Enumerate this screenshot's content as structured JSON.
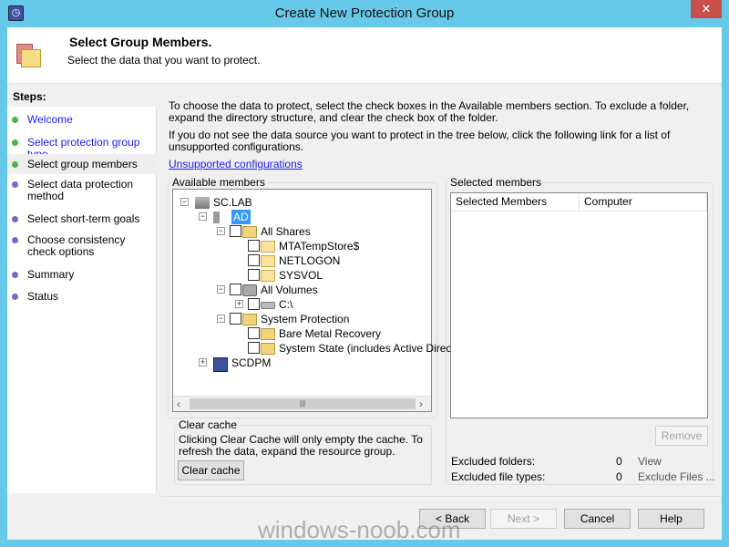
{
  "window": {
    "title": "Create New Protection Group",
    "close_glyph": "✕"
  },
  "header": {
    "title": "Select Group Members.",
    "subtitle": "Select the data that you want to protect."
  },
  "steps": {
    "heading": "Steps:",
    "items": [
      {
        "label": "Welcome",
        "state": "done",
        "link": true
      },
      {
        "label": "Select protection group type",
        "state": "done",
        "link": true
      },
      {
        "label": "Select group members",
        "state": "current",
        "link": false
      },
      {
        "label": "Select data protection method",
        "state": "pending",
        "link": false
      },
      {
        "label": "Select short-term goals",
        "state": "pending",
        "link": false
      },
      {
        "label": "Choose consistency check options",
        "state": "pending",
        "link": false
      },
      {
        "label": "Summary",
        "state": "pending",
        "link": false
      },
      {
        "label": "Status",
        "state": "pending",
        "link": false
      }
    ]
  },
  "colors": {
    "done_dot": "#4db34d",
    "pending_dot": "#6b6bd6",
    "link": "#1a1aff",
    "title_bar": "#67c9e9"
  },
  "main": {
    "intro1": "To choose the data to protect, select the check boxes in the Available members section. To exclude a folder, expand the directory structure, and clear the check box of the folder.",
    "intro2": "If you do not see the data source you want to protect in the tree below, click the following link for a list of unsupported configurations.",
    "unsupported_link": "Unsupported configurations",
    "available_label": "Available members",
    "tree": [
      {
        "label": "SC.LAB",
        "expander": "−",
        "icon": "server-group-icon",
        "checkbox": false
      },
      {
        "label": "AD",
        "expander": "−",
        "icon": "server-icon",
        "checkbox": false,
        "selected": true
      },
      {
        "label": "All Shares",
        "expander": "−",
        "icon": "shares-icon",
        "checkbox": true
      },
      {
        "label": "MTATempStore$",
        "icon": "folder-icon",
        "checkbox": true
      },
      {
        "label": "NETLOGON",
        "icon": "folder-icon",
        "checkbox": true
      },
      {
        "label": "SYSVOL",
        "icon": "folder-icon",
        "checkbox": true
      },
      {
        "label": "All Volumes",
        "expander": "−",
        "icon": "volumes-icon",
        "checkbox": true
      },
      {
        "label": "C:\\",
        "expander": "+",
        "icon": "drive-icon",
        "checkbox": true
      },
      {
        "label": "System Protection",
        "expander": "−",
        "icon": "system-protection-icon",
        "checkbox": true
      },
      {
        "label": "Bare Metal Recovery",
        "icon": "system-protection-icon",
        "checkbox": true
      },
      {
        "label": "System State (includes Active Direct",
        "icon": "system-protection-icon",
        "checkbox": true
      },
      {
        "label": "SCDPM",
        "expander": "+",
        "icon": "dpm-icon",
        "checkbox": false
      }
    ],
    "clear_cache": {
      "legend": "Clear cache",
      "text": "Clicking Clear Cache will only empty the cache. To refresh the data, expand the resource group.",
      "button": "Clear cache"
    },
    "selected": {
      "legend": "Selected members",
      "columns": [
        "Selected Members",
        "Computer"
      ],
      "remove": "Remove",
      "excluded_folders_label": "Excluded folders:",
      "excluded_folders": "0",
      "view_link": "View",
      "excluded_types_label": "Excluded file types:",
      "excluded_types": "0",
      "exclude_files_link": "Exclude Files ..."
    }
  },
  "buttons": {
    "back": "< Back",
    "next": "Next >",
    "cancel": "Cancel",
    "help": "Help"
  },
  "watermark": "windows-noob.com"
}
